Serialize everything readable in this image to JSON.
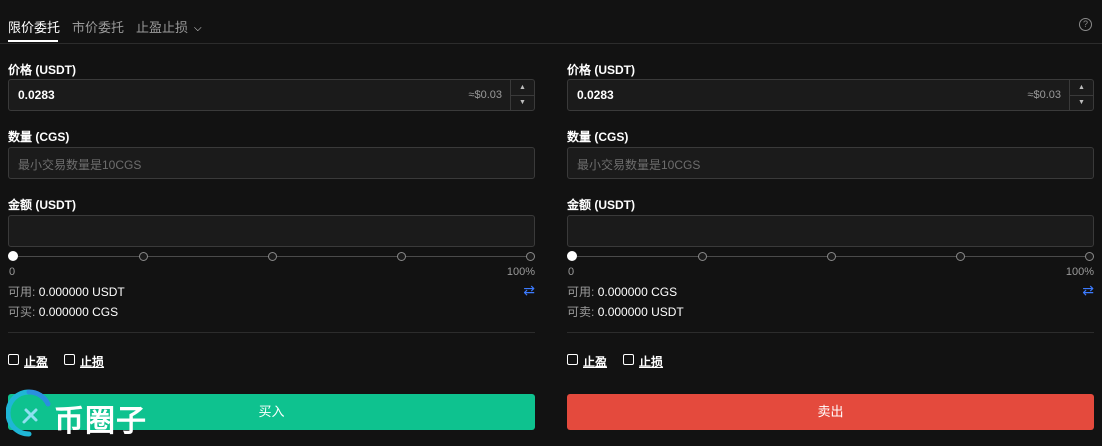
{
  "tabs": {
    "limit": "限价委托",
    "market": "市价委托",
    "tpsl": "止盈止损"
  },
  "icons": {
    "help": "question-circle-icon",
    "chevron": "chevron-down-icon",
    "swap": "swap-icon",
    "step_up": "triangle-up-icon",
    "step_down": "triangle-down-icon",
    "checkbox": "checkbox-icon"
  },
  "buy": {
    "price_label": "价格 (USDT)",
    "price_value": "0.0283",
    "price_approx": "≈$0.03",
    "amount_label": "数量 (CGS)",
    "amount_placeholder": "最小交易数量是10CGS",
    "total_label": "金额 (USDT)",
    "slider_min": "0",
    "slider_max": "100%",
    "slider_percent": 0,
    "available_key": "可用:",
    "available_value": "0.000000 USDT",
    "can_key": "可买:",
    "can_value": "0.000000 CGS",
    "take_profit": "止盈",
    "stop_loss": "止损",
    "button": "买入",
    "color": "#0ec28f"
  },
  "sell": {
    "price_label": "价格 (USDT)",
    "price_value": "0.0283",
    "price_approx": "≈$0.03",
    "amount_label": "数量 (CGS)",
    "amount_placeholder": "最小交易数量是10CGS",
    "total_label": "金额 (USDT)",
    "slider_min": "0",
    "slider_max": "100%",
    "slider_percent": 0,
    "available_key": "可用:",
    "available_value": "0.000000 CGS",
    "can_key": "可卖:",
    "can_value": "0.000000 USDT",
    "take_profit": "止盈",
    "stop_loss": "止损",
    "button": "卖出",
    "color": "#e44a3d"
  },
  "watermark": {
    "text": "币圈子"
  }
}
